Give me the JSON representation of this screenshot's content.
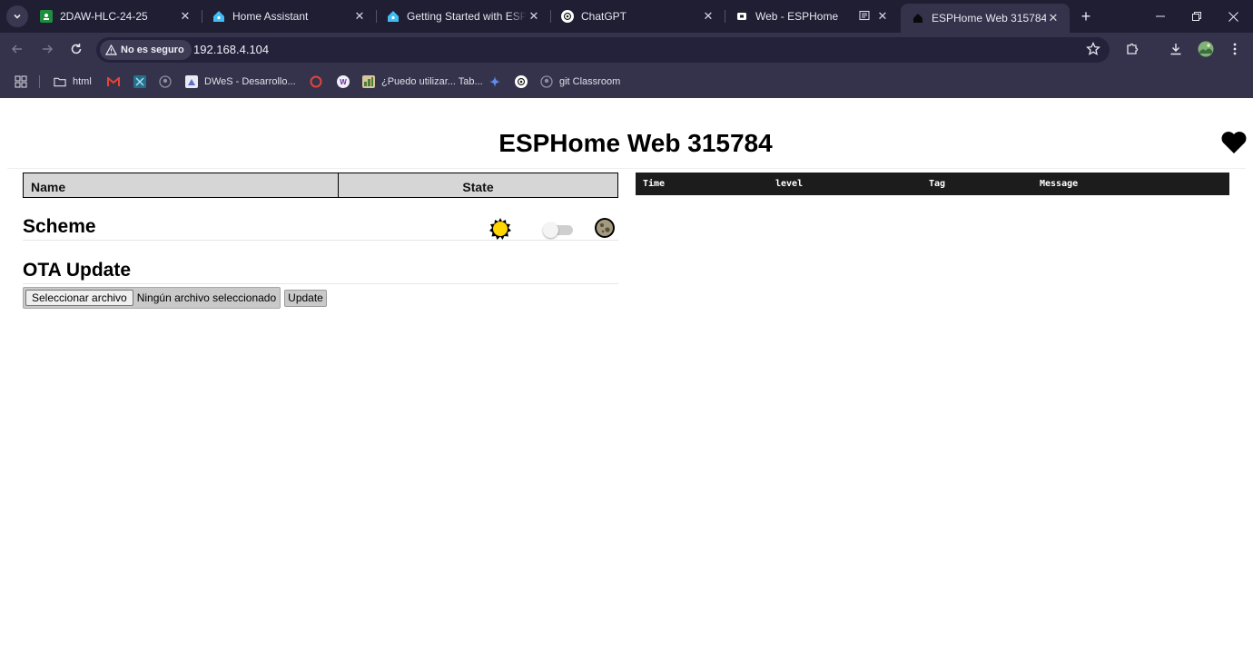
{
  "browser": {
    "tabs": [
      {
        "title": "2DAW-HLC-24-25",
        "icon": "classroom-icon",
        "color": "#1e8e3e"
      },
      {
        "title": "Home Assistant",
        "icon": "home-assistant-icon",
        "color": "#41bdf5"
      },
      {
        "title": "Getting Started with ESPHome",
        "icon": "home-assistant-icon",
        "color": "#41bdf5"
      },
      {
        "title": "ChatGPT",
        "icon": "chatgpt-icon",
        "color": "#ffffff"
      },
      {
        "title": "Web - ESPHome",
        "icon": "esphome-icon",
        "color": "#ffffff"
      },
      {
        "title": "ESPHome Web 315784",
        "icon": "esphome-house-icon",
        "color": "#000000"
      }
    ],
    "security_label": "No es seguro",
    "url": "192.168.4.104",
    "bookmarks": [
      {
        "label": "html",
        "icon": "folder-icon"
      },
      {
        "label": "",
        "icon": "gmail-icon"
      },
      {
        "label": "",
        "icon": "bookmark-app-icon"
      },
      {
        "label": "",
        "icon": "github-icon"
      },
      {
        "label": "DWeS - Desarrollo...",
        "icon": "moodle-icon"
      },
      {
        "label": "",
        "icon": "opera-icon"
      },
      {
        "label": "",
        "icon": "w-icon"
      },
      {
        "label": "¿Puedo utilizar... Tab...",
        "icon": "caniuse-icon"
      },
      {
        "label": "",
        "icon": "gemini-icon"
      },
      {
        "label": "",
        "icon": "chatgpt-icon"
      },
      {
        "label": "git Classroom",
        "icon": "github-icon"
      }
    ]
  },
  "page": {
    "title": "ESPHome Web 315784",
    "entity_table": {
      "columns": [
        "Name",
        "State"
      ]
    },
    "scheme": {
      "title": "Scheme",
      "dark_mode": false
    },
    "ota": {
      "title": "OTA Update",
      "file_button": "Seleccionar archivo",
      "file_status": "Ningún archivo seleccionado",
      "update_button": "Update"
    },
    "log_table": {
      "columns": [
        "Time",
        "level",
        "Tag",
        "Message"
      ]
    }
  },
  "colors": {
    "tabstrip": "#1f1e33",
    "toolbar": "#35334b",
    "log_header": "#1c1c1c",
    "table_header": "#d6d6d6"
  }
}
